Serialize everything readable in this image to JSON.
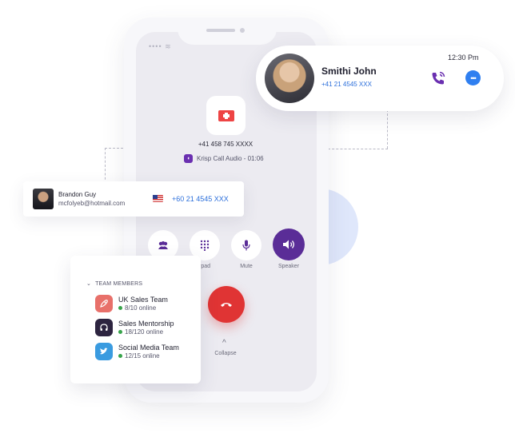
{
  "phone": {
    "call_number": "+41 458 745 XXXX",
    "krisp_label": "Krisp Call Audio - 01:06",
    "controls": [
      {
        "label": "",
        "icon": "contacts-icon"
      },
      {
        "label": "eypad",
        "icon": "keypad-icon"
      },
      {
        "label": "Mute",
        "icon": "microphone-icon"
      },
      {
        "label": "Speaker",
        "icon": "speaker-icon"
      }
    ],
    "collapse_label": "Collapse"
  },
  "contact_card": {
    "name": "Smithi John",
    "number": "+41 21 4545 XXX",
    "time": "12:30 Pm"
  },
  "caller_card": {
    "name": "Brandon Guy",
    "email": "mcfolyeb@hotmail.com",
    "number": "+60 21 4545 XXX"
  },
  "team_panel": {
    "header": "TEAM MEMBERS",
    "teams": [
      {
        "name": "UK Sales Team",
        "online": "8/10 online",
        "color": "#e8706a",
        "icon": "rocket-icon"
      },
      {
        "name": "Sales Mentorship",
        "online": "18/120 online",
        "color": "#2d2440",
        "icon": "headphones-icon"
      },
      {
        "name": "Social Media Team",
        "online": "12/15 online",
        "color": "#3a9be0",
        "icon": "twitter-icon"
      }
    ]
  },
  "colors": {
    "accent_purple": "#5a2d97",
    "link_blue": "#2c6fdb",
    "hangup_red": "#e03434",
    "online_green": "#37a34a"
  }
}
